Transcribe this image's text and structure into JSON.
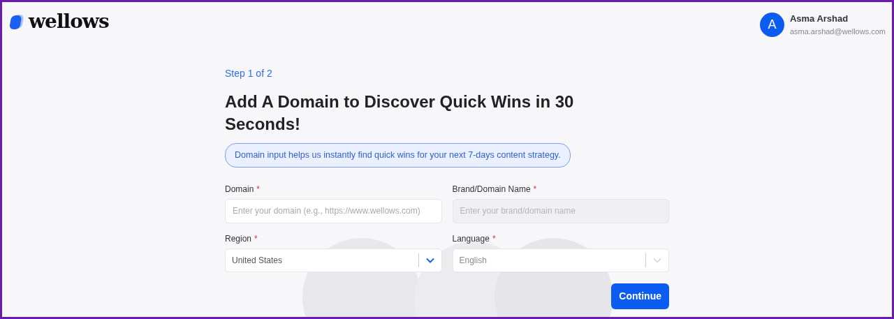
{
  "logo": {
    "text": "wellows"
  },
  "user": {
    "initial": "A",
    "name": "Asma Arshad",
    "email": "asma.arshad@wellows.com"
  },
  "step": "Step 1 of 2",
  "heading": "Add A Domain to Discover Quick Wins in 30 Seconds!",
  "info": "Domain input helps us instantly find quick wins for your next 7-days content strategy.",
  "fields": [
    {
      "kind": "text",
      "label": "Domain",
      "required_mark": "*",
      "placeholder": "Enter your domain (e.g., https://www.wellows.com)",
      "disabled": false
    },
    {
      "kind": "text",
      "label": "Brand/Domain Name",
      "required_mark": "*",
      "placeholder": "Enter your brand/domain name",
      "disabled": true
    },
    {
      "kind": "select",
      "label": "Region",
      "required_mark": "*",
      "value": "United States",
      "disabled": false
    },
    {
      "kind": "select",
      "label": "Language",
      "required_mark": "*",
      "value": "English",
      "disabled": true
    }
  ],
  "button": "Continue"
}
